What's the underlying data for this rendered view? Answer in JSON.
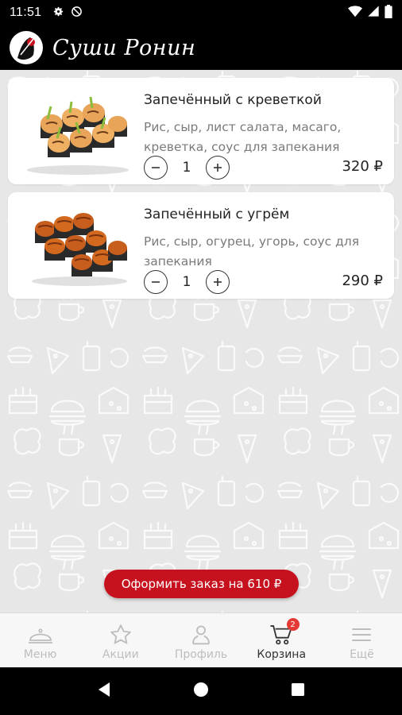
{
  "status_bar": {
    "time": "11:51"
  },
  "app": {
    "title": "Суши Ронин"
  },
  "cart_items": [
    {
      "title": "Запечённый с креветкой",
      "description": "Рис, сыр, лист салата, масаго, креветка, соус для запекания",
      "quantity": "1",
      "price": "320 ₽"
    },
    {
      "title": "Запечённый с угрём",
      "description": "Рис, сыр, огурец, угорь, соус для запекания",
      "quantity": "1",
      "price": "290 ₽"
    }
  ],
  "order_button": {
    "label": "Оформить заказ на 610 ₽"
  },
  "bottom_nav": {
    "items": [
      {
        "label": "Меню",
        "icon": "cloche-icon"
      },
      {
        "label": "Акции",
        "icon": "star-icon"
      },
      {
        "label": "Профиль",
        "icon": "person-icon"
      },
      {
        "label": "Корзина",
        "icon": "cart-icon",
        "badge": "2",
        "active": true
      },
      {
        "label": "Ещё",
        "icon": "menu-icon"
      }
    ]
  },
  "colors": {
    "accent": "#c6111e",
    "badge": "#e53935",
    "background": "#e7e7e7"
  }
}
